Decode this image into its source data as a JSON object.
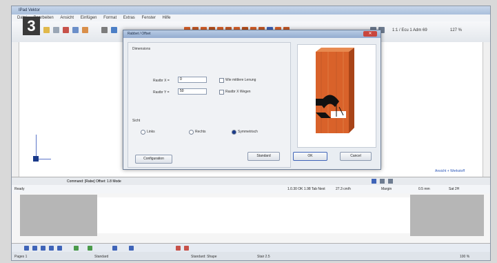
{
  "step_number": "3",
  "window": {
    "title": "IPad Vektor",
    "menu": [
      "Datei",
      "Bearbeiten",
      "Ansicht",
      "Einfügen",
      "Format",
      "Extras",
      "Fenster",
      "Hilfe"
    ]
  },
  "toolbar": {
    "scale_text": "1:1 / Ecu 1 Adm 69",
    "zoom_text": "127 %"
  },
  "canvas": {
    "link_text": "Ansicht + Werkstoff"
  },
  "command_line": {
    "text": "Command: [Rabe] Offset: 1.8 Mode"
  },
  "statusbar": {
    "left": "Ready",
    "coords": "1.0.30 OK 1.98 Tab Next",
    "value1": "27.3 cm/h",
    "value2": "Margin",
    "value3": "0.5 mm",
    "value4": "Sat 2H"
  },
  "dialog": {
    "title": "Rabbet / Offset",
    "section_label": "Dimensions",
    "field_x_label": "Rastbr X =",
    "field_x_value": "0",
    "field_y_label": "Rastbr Y =",
    "field_y_value": "50",
    "check_same_label": "Wie mittlere Lenung",
    "check_mirror_label": "Rastbr X Wegen",
    "group_label": "Sicht",
    "radio_left": "Links",
    "radio_right": "Rechts",
    "radio_center": "Symmetrisch",
    "config_button": "Configuration",
    "standard_button": "Standard",
    "ok_button": "OK",
    "cancel_button": "Cancel"
  },
  "pagebar": {
    "page_label": "Pages 1",
    "mode_label": "Standard",
    "style_label": "Standard: Shape",
    "ratio_label": "Stair 2.5",
    "zoom_label": "100 %"
  },
  "colors": {
    "wood": "#d9622a",
    "wood_dark": "#a84418",
    "accent": "#1a3a8a",
    "close_red": "#c9463d"
  }
}
